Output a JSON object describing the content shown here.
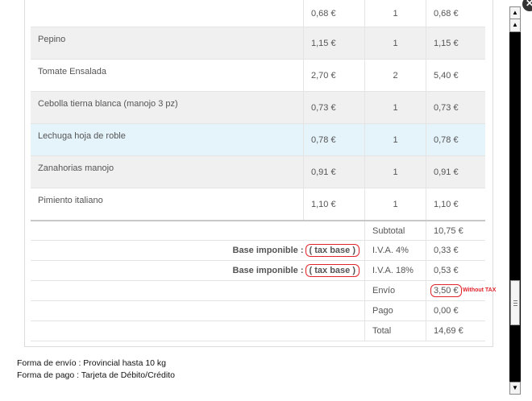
{
  "top_row": {
    "name": "",
    "price": "0,68 €",
    "qty": "1",
    "total": "0,68 €"
  },
  "items": [
    {
      "name": "Pepino",
      "price": "1,15 €",
      "qty": "1",
      "total": "1,15 €"
    },
    {
      "name": "Tomate Ensalada",
      "price": "2,70 €",
      "qty": "2",
      "total": "5,40 €"
    },
    {
      "name": "Cebolla tierna blanca (manojo 3 pz)",
      "price": "0,73 €",
      "qty": "1",
      "total": "0,73 €"
    },
    {
      "name": "Lechuga hoja de roble",
      "price": "0,78 €",
      "qty": "1",
      "total": "0,78 €"
    },
    {
      "name": "Zanahorias manojo",
      "price": "0,91 €",
      "qty": "1",
      "total": "0,91 €"
    },
    {
      "name": "Pimiento italiano",
      "price": "1,10 €",
      "qty": "1",
      "total": "1,10 €"
    }
  ],
  "summary": {
    "subtotal_label": "Subtotal",
    "subtotal_value": "10,75 €",
    "iva4_label": "I.V.A. 4%",
    "iva4_value": "0,33 €",
    "iva18_label": "I.V.A. 18%",
    "iva18_value": "0,53 €",
    "envio_label": "Envío",
    "envio_value": "3,50 €",
    "pago_label": "Pago",
    "pago_value": "0,00 €",
    "total_label": "Total",
    "total_value": "14,69 €",
    "base_label": "Base imponible :",
    "tax_base_tag": "( tax base )"
  },
  "annotation": {
    "without_tax": "Without TAX"
  },
  "footer": {
    "shipping": "Forma de envío : Provincial hasta 10 kg",
    "payment": "Forma de pago : Tarjeta de Débito/Crédito"
  },
  "colors": {
    "annotation_red": "#e0242b",
    "highlight_row": "#e5f3fa",
    "alt_row": "#f0f0f0"
  }
}
